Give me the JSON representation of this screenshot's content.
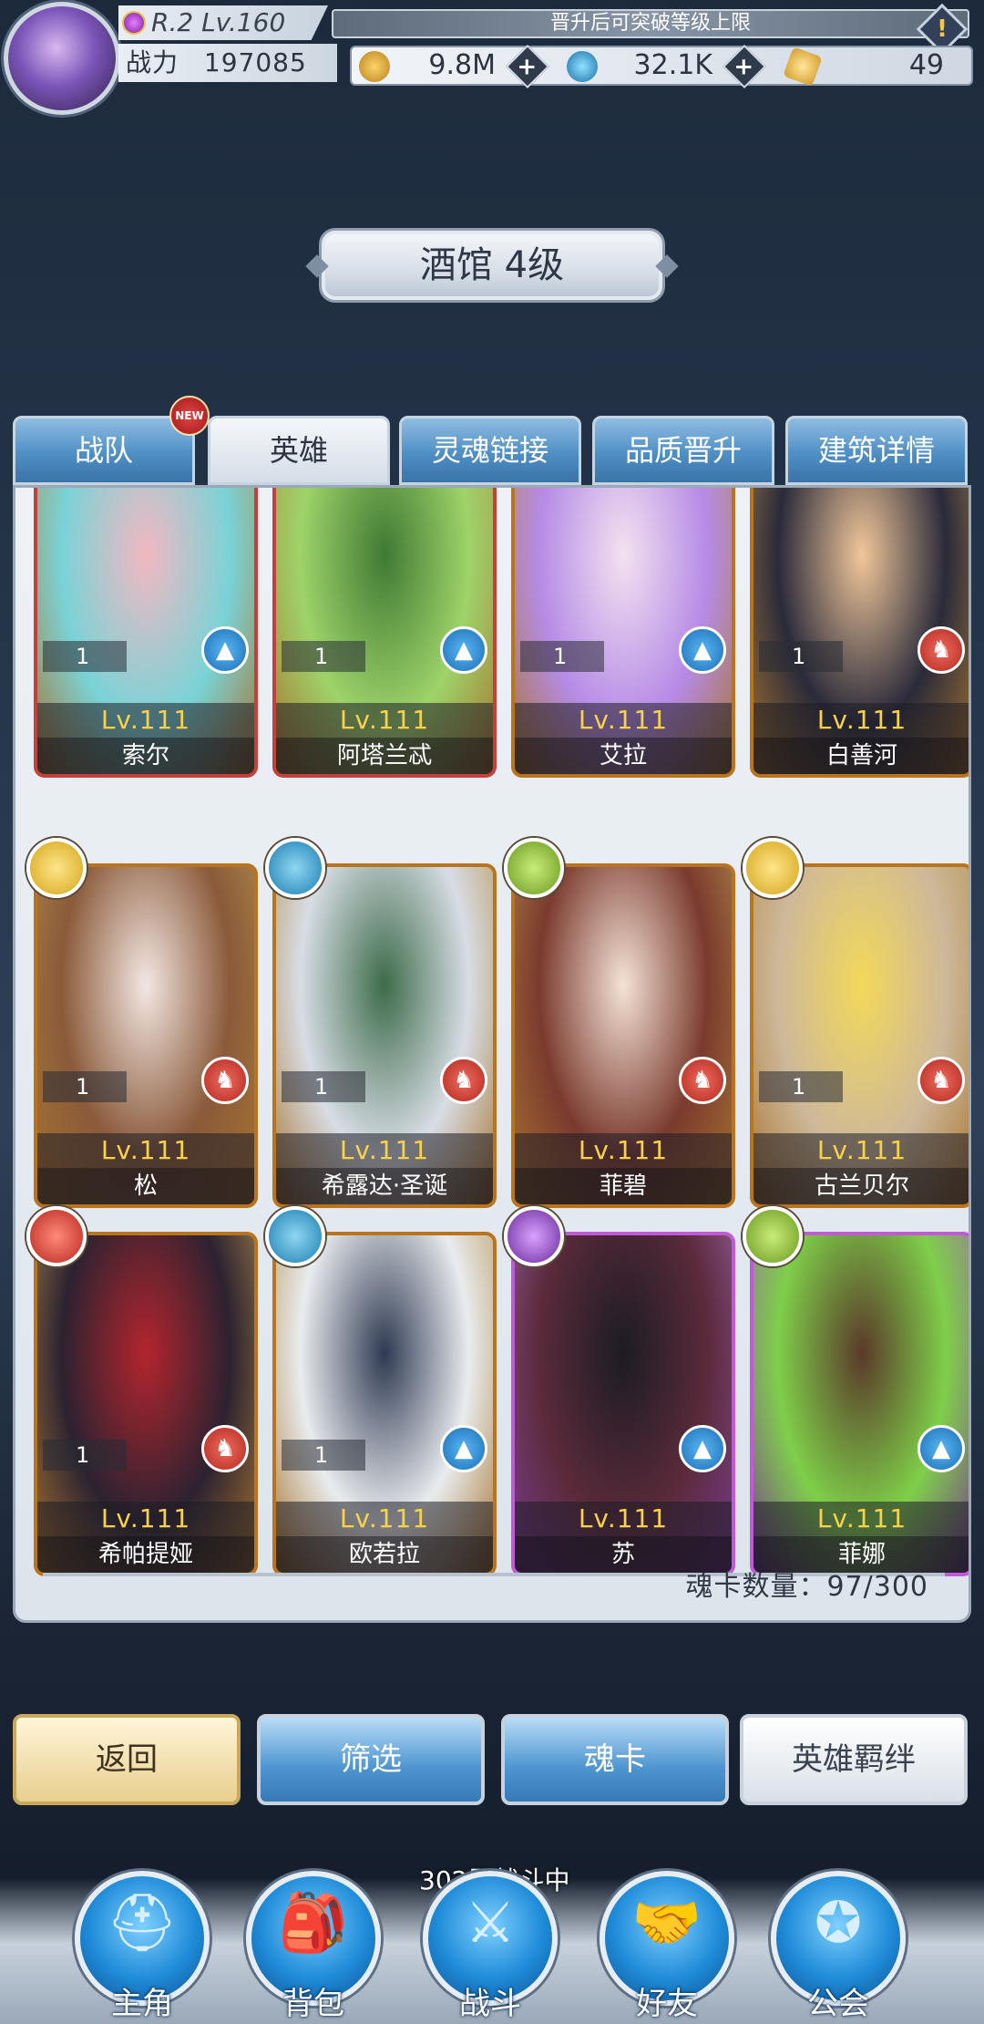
{
  "header": {
    "rank_level": "R.2 Lv.160",
    "power_label": "战力",
    "power_value": "197085",
    "notice": "晋升后可突破等级上限",
    "gold": "9.8M",
    "crystals": "32.1K",
    "tickets": "49"
  },
  "title": "酒馆 4级",
  "tabs": [
    {
      "label": "战队",
      "active": false,
      "badge": "NEW"
    },
    {
      "label": "英雄",
      "active": true
    },
    {
      "label": "灵魂链接",
      "active": false
    },
    {
      "label": "品质晋升",
      "active": false
    },
    {
      "label": "建筑详情",
      "active": false
    }
  ],
  "heroes": [
    {
      "name": "索尔",
      "level": "Lv.111",
      "count": "1",
      "class": "mage",
      "faction": "yellow",
      "border": "red",
      "art": [
        "#79d3d6",
        "#f2b8c2"
      ]
    },
    {
      "name": "阿塔兰忒",
      "level": "Lv.111",
      "count": "1",
      "class": "mage",
      "faction": "green",
      "border": "red",
      "art": [
        "#9ed36a",
        "#3f7a34"
      ]
    },
    {
      "name": "艾拉",
      "level": "Lv.111",
      "count": "1",
      "class": "mage",
      "faction": "yellow",
      "border": "gold",
      "art": [
        "#b68be6",
        "#f3e2f0"
      ]
    },
    {
      "name": "白善河",
      "level": "Lv.111",
      "count": "1",
      "class": "warrior",
      "faction": "blue",
      "border": "gold",
      "art": [
        "#2a2a3a",
        "#f0c79a"
      ]
    },
    {
      "name": "松",
      "level": "Lv.111",
      "count": "1",
      "class": "warrior",
      "faction": "yellow",
      "border": "gold",
      "art": [
        "#8a5a3a",
        "#f3e7e3"
      ]
    },
    {
      "name": "希露达·圣诞",
      "level": "Lv.111",
      "count": "1",
      "class": "warrior",
      "faction": "blue",
      "border": "gold",
      "art": [
        "#d8dde5",
        "#3d6b4a"
      ]
    },
    {
      "name": "菲碧",
      "level": "Lv.111",
      "count": "",
      "class": "warrior",
      "faction": "green",
      "border": "gold",
      "art": [
        "#7a3a2e",
        "#f4e3d6"
      ]
    },
    {
      "name": "古兰贝尔",
      "level": "Lv.111",
      "count": "1",
      "class": "warrior",
      "faction": "yellow",
      "border": "gold",
      "art": [
        "#cdb89a",
        "#f3d85a"
      ]
    },
    {
      "name": "希帕提娅",
      "level": "Lv.111",
      "count": "1",
      "class": "warrior",
      "faction": "red",
      "border": "gold",
      "art": [
        "#2c2230",
        "#b3252e"
      ]
    },
    {
      "name": "欧若拉",
      "level": "Lv.111",
      "count": "1",
      "class": "mage",
      "faction": "blue",
      "border": "gold",
      "art": [
        "#e9ecef",
        "#2f3a52"
      ]
    },
    {
      "name": "苏",
      "level": "Lv.111",
      "count": "",
      "class": "mage",
      "faction": "purple",
      "border": "purple",
      "art": [
        "#5a2a3a",
        "#1c1c24"
      ]
    },
    {
      "name": "菲娜",
      "level": "Lv.111",
      "count": "",
      "class": "mage",
      "faction": "green",
      "border": "purple",
      "art": [
        "#7fcf4a",
        "#5a3a2a"
      ]
    }
  ],
  "soul_card_count": "魂卡数量：97/300",
  "actions": {
    "back": "返回",
    "filter": "筛选",
    "soul_card": "魂卡",
    "hero_bond": "英雄羁绊"
  },
  "battle_status": "302层战斗中",
  "nav": [
    {
      "label": "主角",
      "icon": "helmet-icon",
      "glyph": "⛑"
    },
    {
      "label": "背包",
      "icon": "backpack-icon",
      "glyph": "🎒"
    },
    {
      "label": "战斗",
      "icon": "crossed-swords-icon",
      "glyph": "⚔"
    },
    {
      "label": "好友",
      "icon": "handshake-icon",
      "glyph": "🤝"
    },
    {
      "label": "公会",
      "icon": "guild-crest-icon",
      "glyph": "✪"
    }
  ]
}
